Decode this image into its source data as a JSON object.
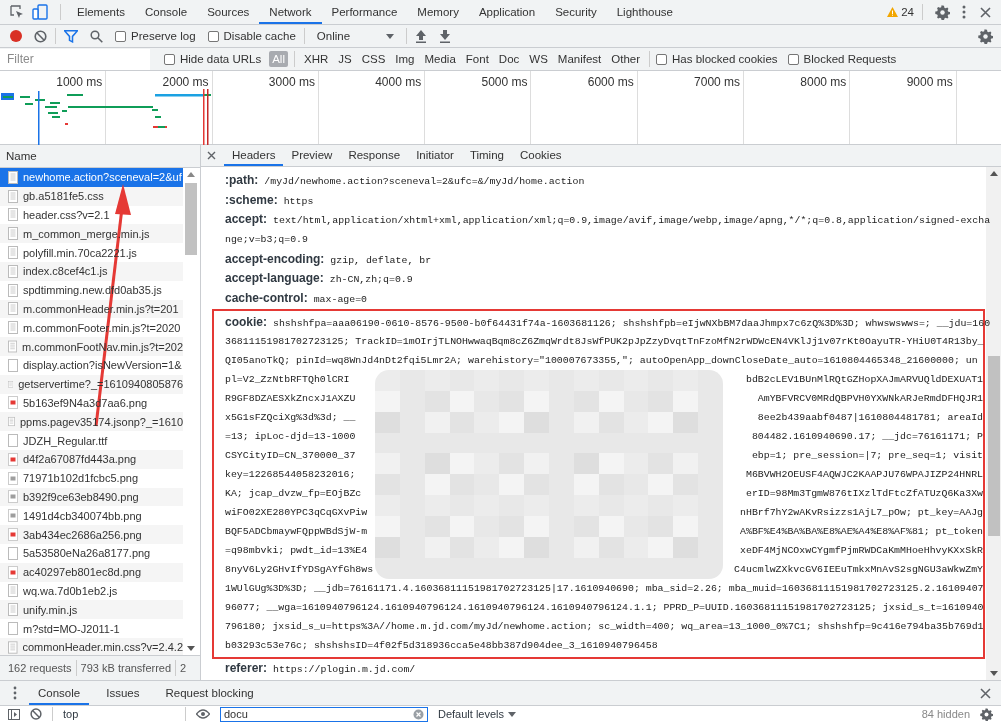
{
  "main_tabs": [
    {
      "label": "Elements",
      "selected": false
    },
    {
      "label": "Console",
      "selected": false
    },
    {
      "label": "Sources",
      "selected": false
    },
    {
      "label": "Network",
      "selected": true
    },
    {
      "label": "Performance",
      "selected": false
    },
    {
      "label": "Memory",
      "selected": false
    },
    {
      "label": "Application",
      "selected": false
    },
    {
      "label": "Security",
      "selected": false
    },
    {
      "label": "Lighthouse",
      "selected": false
    }
  ],
  "warnings": "24",
  "toolbar": {
    "recording": true,
    "preserve_log": {
      "label": "Preserve log",
      "checked": false
    },
    "disable_cache": {
      "label": "Disable cache",
      "checked": false
    },
    "throttling": "Online"
  },
  "filter": {
    "placeholder": "Filter",
    "hide_data_urls": {
      "label": "Hide data URLs",
      "checked": false
    },
    "types": [
      {
        "label": "All",
        "selected": true
      },
      {
        "label": "XHR",
        "selected": false
      },
      {
        "label": "JS",
        "selected": false
      },
      {
        "label": "CSS",
        "selected": false
      },
      {
        "label": "Img",
        "selected": false
      },
      {
        "label": "Media",
        "selected": false
      },
      {
        "label": "Font",
        "selected": false
      },
      {
        "label": "Doc",
        "selected": false
      },
      {
        "label": "WS",
        "selected": false
      },
      {
        "label": "Manifest",
        "selected": false
      },
      {
        "label": "Other",
        "selected": false
      }
    ],
    "has_blocked_cookies": {
      "label": "Has blocked cookies",
      "checked": false
    },
    "blocked_requests": {
      "label": "Blocked Requests",
      "checked": false
    }
  },
  "overview": {
    "ticks": [
      "1000 ms",
      "2000 ms",
      "3000 ms",
      "4000 ms",
      "5000 ms",
      "6000 ms",
      "7000 ms",
      "8000 ms",
      "9000 ms"
    ]
  },
  "requests": {
    "column": "Name",
    "rows": [
      {
        "name": "newhome.action?sceneval=2&uf",
        "kind": "doc",
        "selected": true
      },
      {
        "name": "gb.a5181fe5.css",
        "kind": "doc",
        "selected": false
      },
      {
        "name": "header.css?v=2.1",
        "kind": "doc",
        "selected": false
      },
      {
        "name": "m_common_merge.min.js",
        "kind": "doc",
        "selected": false
      },
      {
        "name": "polyfill.min.70ca2221.js",
        "kind": "doc",
        "selected": false
      },
      {
        "name": "index.c8cef4c1.js",
        "kind": "doc",
        "selected": false
      },
      {
        "name": "spdtimming.new.dfd0ab35.js",
        "kind": "doc",
        "selected": false
      },
      {
        "name": "m.commonHeader.min.js?t=201",
        "kind": "doc",
        "selected": false
      },
      {
        "name": "m.commonFooter.min.js?t=2020",
        "kind": "doc",
        "selected": false
      },
      {
        "name": "m.commonFootNav.min.js?t=202",
        "kind": "doc",
        "selected": false
      },
      {
        "name": "display.action?isNewVersion=1&",
        "kind": "blank",
        "selected": false
      },
      {
        "name": "getservertime?_=1610940805876",
        "kind": "doc",
        "selected": false
      },
      {
        "name": "5b163ef9N4a3d7aa6.png",
        "kind": "image",
        "color": "#e53935",
        "selected": false
      },
      {
        "name": "ppms.pagev35174.jsonp?_=1610",
        "kind": "doc",
        "selected": false
      },
      {
        "name": "JDZH_Regular.ttf",
        "kind": "blank",
        "selected": false
      },
      {
        "name": "d4f2a67087fd443a.png",
        "kind": "image",
        "color": "#e53935",
        "selected": false
      },
      {
        "name": "71971b102d1fcbc5.png",
        "kind": "image",
        "color": "#9e9e9e",
        "selected": false
      },
      {
        "name": "b392f9ce63eb8490.png",
        "kind": "image",
        "color": "#9e9e9e",
        "selected": false
      },
      {
        "name": "1491d4cb340074bb.png",
        "kind": "image",
        "color": "#9e9e9e",
        "selected": false
      },
      {
        "name": "3ab434ec2686a256.png",
        "kind": "image",
        "color": "#e53935",
        "selected": false
      },
      {
        "name": "5a53580eNa26a8177.png",
        "kind": "blank",
        "selected": false
      },
      {
        "name": "ac40297eb801ec8d.png",
        "kind": "image",
        "color": "#e53935",
        "selected": false
      },
      {
        "name": "wq.wa.7d0b1eb2.js",
        "kind": "doc",
        "selected": false
      },
      {
        "name": "unify.min.js",
        "kind": "doc",
        "selected": false
      },
      {
        "name": "m?std=MO-J2011-1",
        "kind": "blank",
        "selected": false
      },
      {
        "name": "commonHeader.min.css?v=2.4.2",
        "kind": "doc",
        "selected": false
      }
    ]
  },
  "status_bar": [
    "162 requests",
    "793 kB transferred",
    "2"
  ],
  "detail_tabs": [
    {
      "label": "Headers",
      "selected": true
    },
    {
      "label": "Preview",
      "selected": false
    },
    {
      "label": "Response",
      "selected": false
    },
    {
      "label": "Initiator",
      "selected": false
    },
    {
      "label": "Timing",
      "selected": false
    },
    {
      "label": "Cookies",
      "selected": false
    }
  ],
  "headers": [
    {
      "name": ":path:",
      "highlighted": false,
      "lines": [
        "/myJd/newhome.action?sceneval=2&ufc=&/myJd/home.action"
      ]
    },
    {
      "name": ":scheme:",
      "highlighted": false,
      "lines": [
        "https"
      ]
    },
    {
      "name": "accept:",
      "highlighted": false,
      "lines": [
        "text/html,application/xhtml+xml,application/xml;q=0.9,image/avif,image/webp,image/apng,*/*;q=0.8,application/signed-excha",
        "nge;v=b3;q=0.9"
      ]
    },
    {
      "name": "accept-encoding:",
      "highlighted": false,
      "lines": [
        "gzip, deflate, br"
      ]
    },
    {
      "name": "accept-language:",
      "highlighted": false,
      "lines": [
        "zh-CN,zh;q=0.9"
      ]
    },
    {
      "name": "cache-control:",
      "highlighted": false,
      "lines": [
        "max-age=0"
      ]
    },
    {
      "name": "cookie:",
      "highlighted": true,
      "lines": [
        "shshshfpa=aaa06190-0610-8576-9500-b0f64431f74a-1603681126; shshshfpb=eIjwNXbBM7daaJhmpx7c6zQ%3D%3D; whwswswws=; __jdu=160",
        "36811151981702723125; TrackID=1mOIrjTLNOHwwaqBqm8cZ6ZmqWrdt8JsWfPUK2pJpZzyDvqtTnFzoMfN2rWDWcEN4VKlJj1v07rKt0OayuTR-YHiU0T4R13by_",
        "QI05anoTkQ; pinId=wq8WnJd4nDt2fqi5Lmr2A; warehistory=\"100007673355,\"; autoOpenApp_downCloseDate_auto=1610804465348_21600000; un",
        {
          "left": "pl=V2_ZzNtbRFTQh0lCRI",
          "right": "bdB2cLEV1BUnMlRQtGZHopXAJmARVUQldDEXUAT1"
        },
        {
          "left": "R9GF8DZAESXkZncxJ1AXZU",
          "right": "AmYBFVRCV0MRdQBPVH0YXWNkARJeRmdDFHQJR1"
        },
        {
          "left": "x5G1sFZQciXg%3d%3d; __",
          "right": "8ee2b439aabf0487|1610804481781; areaId"
        },
        {
          "left": "=13; ipLoc-djd=13-1000",
          "right": "804482.1610940690.17; __jdc=76161171; P"
        },
        {
          "left": "CSYCityID=CN_370000_37",
          "right": "ebp=1; pre_session=|7; pre_seq=1; visit"
        },
        {
          "left": "key=12268544058232016;",
          "right": "M6BVWH2OEUSF4AQWJC2KAAPJU76WPAJIZP24HNRL"
        },
        {
          "left": "KA; jcap_dvzw_fp=EOjBZc",
          "right": "erID=98Mm3TgmW876tIXzlTdFtcZfATUzQ6Ka3Xw"
        },
        {
          "left": "wiFO02XE280YPC3qCqGXvPiw",
          "right": "nHBrf7hY2wAKvRsizzs1AjL7_pOw; pt_key=AAJg"
        },
        {
          "left": "BQF5ADCbmaywFQppWBdSjW-m",
          "right": "A%BF%E4%BA%BA%E8%AE%A4%E8%AF%81; pt_token"
        },
        {
          "left": "=q98mbvki; pwdt_id=13%E4",
          "right": "xeDF4MjNCOxwCYgmfPjmRWDCaKmMHoeHhvyKXxSkR"
        },
        {
          "left": "8nyV6Ly2GHvIfYDSgAYfGh8ws",
          "right": "C4ucmlwZXkvcGV6IEEuTmkxMnAvS2sgNGU3aWkwZmY"
        },
        "1WUlGUg%3D%3D; __jdb=76161171.4.16036811151981702723125|17.1610940690; mba_sid=2.26; mba_muid=16036811151981702723125.2.16109407",
        "96077; __wga=1610940796124.1610940796124.1610940796124.1610940796124.1.1; PPRD_P=UUID.16036811151981702723125; jxsid_s_t=1610940",
        "796180; jxsid_s_u=https%3A//home.m.jd.com/myJd/newhome.action; sc_width=400; wq_area=13_1000_0%7C1; shshshfp=9c416e794ba35b769d1",
        "b03293c53e76c; shshshsID=4f02f5d318936cca5e48bb387d904dee_3_1610940796458"
      ]
    },
    {
      "name": "referer:",
      "highlighted": false,
      "lines": [
        "https://plogin.m.jd.com/"
      ]
    }
  ],
  "drawer": {
    "tabs": [
      {
        "label": "Console",
        "selected": true
      },
      {
        "label": "Issues",
        "selected": false
      },
      {
        "label": "Request blocking",
        "selected": false
      }
    ],
    "context": "top",
    "filter_value": "docu",
    "levels": "Default levels",
    "hidden": "84 hidden"
  }
}
